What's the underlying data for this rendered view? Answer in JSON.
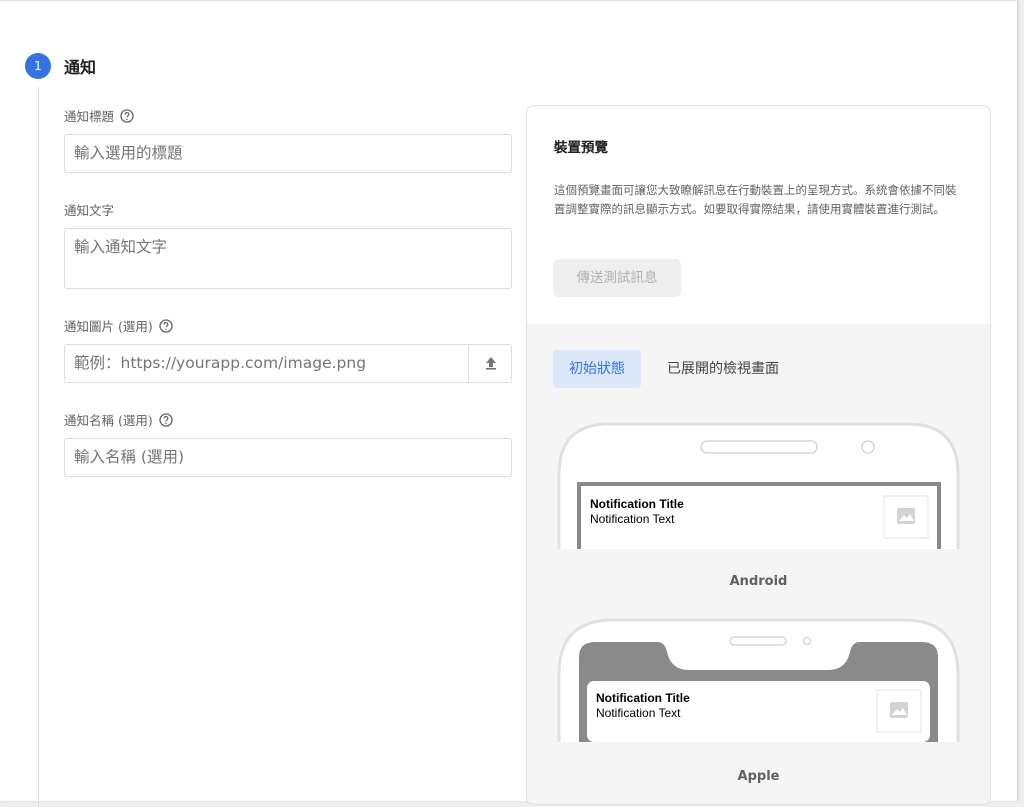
{
  "step": {
    "number": "1",
    "title": "通知"
  },
  "fields": {
    "title": {
      "label": "通知標題",
      "placeholder": "輸入選用的標題"
    },
    "text": {
      "label": "通知文字",
      "placeholder": "輸入通知文字"
    },
    "image": {
      "label": "通知圖片 (選用)",
      "placeholder": "範例：https://yourapp.com/image.png"
    },
    "name": {
      "label": "通知名稱 (選用)",
      "placeholder": "輸入名稱 (選用)"
    }
  },
  "preview": {
    "title": "裝置預覽",
    "description": "這個預覽畫面可讓您大致瞭解訊息在行動裝置上的呈現方式。系統會依據不同裝置調整實際的訊息顯示方式。如要取得實際結果，請使用實體裝置進行測試。",
    "send_test_label": "傳送測試訊息",
    "tabs": [
      {
        "label": "初始狀態",
        "active": true
      },
      {
        "label": "已展開的檢視畫面",
        "active": false
      }
    ],
    "android": {
      "label": "Android",
      "notif_title": "Notification Title",
      "notif_text": "Notification Text"
    },
    "apple": {
      "label": "Apple",
      "notif_title": "Notification Title",
      "notif_text": "Notification Text"
    }
  },
  "icons": {
    "help": "help-circle-icon",
    "upload": "upload-icon",
    "image": "image-placeholder-icon"
  },
  "colors": {
    "accent": "#3574e0",
    "accent_light": "#dce7fa"
  }
}
